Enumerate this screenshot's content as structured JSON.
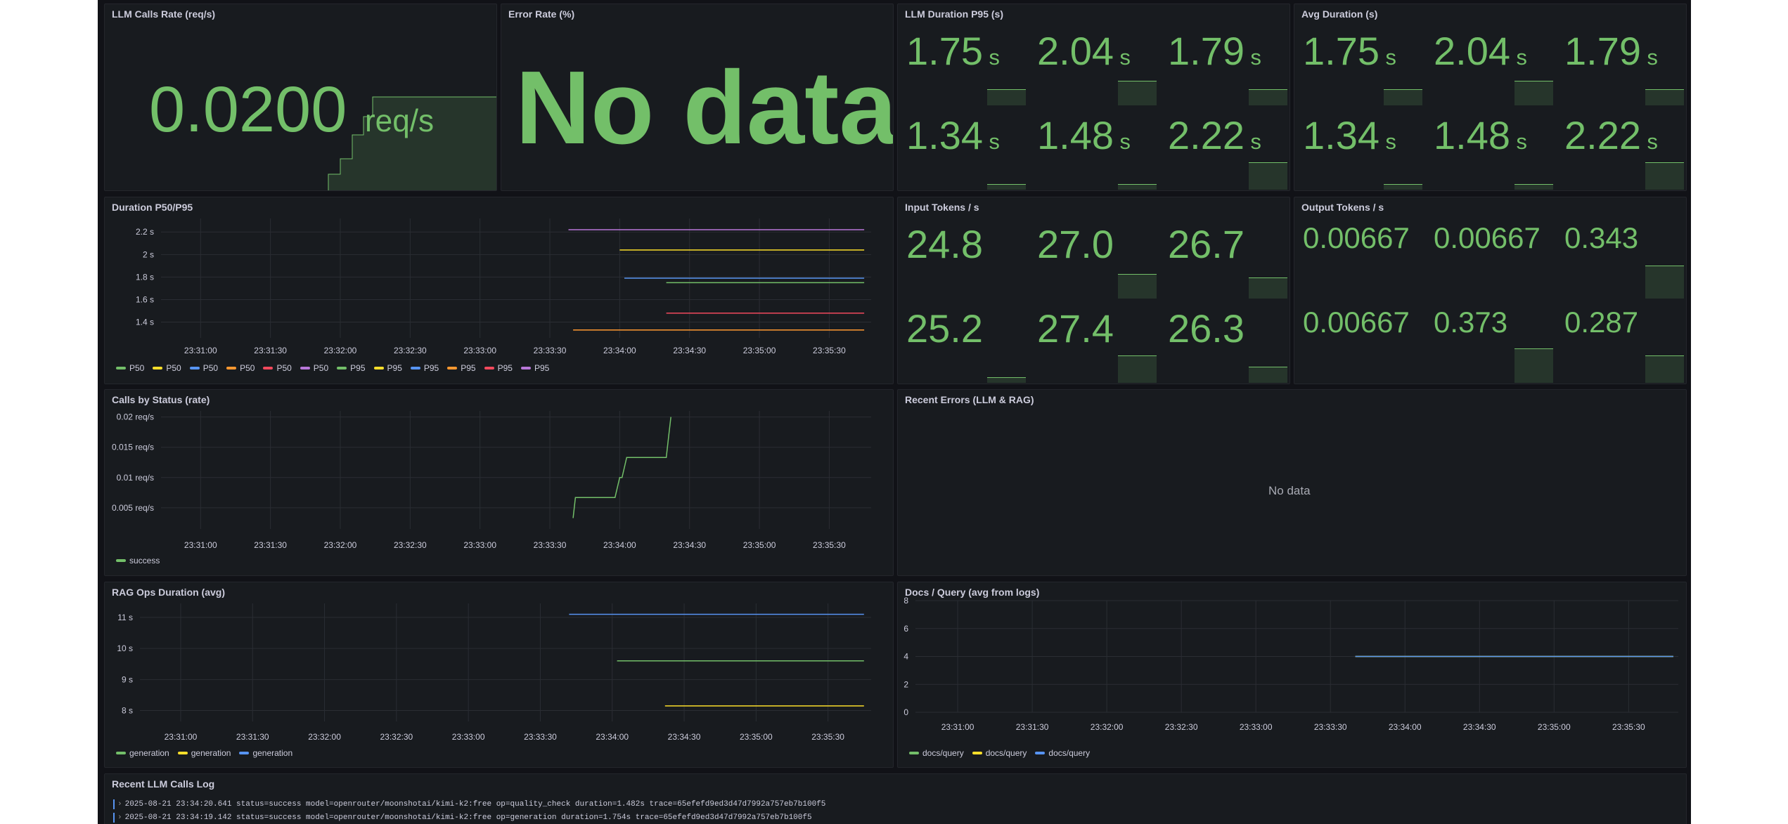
{
  "colors": {
    "green": "#73bf69",
    "yellow": "#fade2a",
    "blue": "#5794f2",
    "orange": "#ff9830",
    "red": "#f2495c",
    "purple": "#b877d9"
  },
  "panels": {
    "llm_calls_rate": {
      "title": "LLM Calls Rate (req/s)",
      "value": "0.0200",
      "unit": "req/s"
    },
    "error_rate": {
      "title": "Error Rate (%)",
      "value": "No data"
    },
    "llm_duration_p95": {
      "title": "LLM Duration P95 (s)",
      "cells": [
        {
          "value": "1.75",
          "unit": "s",
          "level": 0.45
        },
        {
          "value": "2.04",
          "unit": "s",
          "level": 0.7
        },
        {
          "value": "1.79",
          "unit": "s",
          "level": 0.45
        },
        {
          "value": "1.34",
          "unit": "s",
          "level": 0.15
        },
        {
          "value": "1.48",
          "unit": "s",
          "level": 0.15
        },
        {
          "value": "2.22",
          "unit": "s",
          "level": 0.8
        }
      ]
    },
    "avg_duration": {
      "title": "Avg Duration (s)",
      "cells": [
        {
          "value": "1.75",
          "unit": "s",
          "level": 0.45
        },
        {
          "value": "2.04",
          "unit": "s",
          "level": 0.7
        },
        {
          "value": "1.79",
          "unit": "s",
          "level": 0.45
        },
        {
          "value": "1.34",
          "unit": "s",
          "level": 0.15
        },
        {
          "value": "1.48",
          "unit": "s",
          "level": 0.15
        },
        {
          "value": "2.22",
          "unit": "s",
          "level": 0.8
        }
      ]
    },
    "duration_p50_p95": {
      "title": "Duration P50/P95"
    },
    "input_tokens": {
      "title": "Input Tokens / s",
      "cells": [
        {
          "value": "24.8",
          "level": 0
        },
        {
          "value": "27.0",
          "level": 0.7
        },
        {
          "value": "26.7",
          "level": 0.6
        },
        {
          "value": "25.2",
          "level": 0.15
        },
        {
          "value": "27.4",
          "level": 0.8
        },
        {
          "value": "26.3",
          "level": 0.45
        }
      ]
    },
    "output_tokens": {
      "title": "Output Tokens / s",
      "cells": [
        {
          "value": "0.00667",
          "level": 0
        },
        {
          "value": "0.00667",
          "level": 0
        },
        {
          "value": "0.343",
          "level": 0.95
        },
        {
          "value": "0.00667",
          "level": 0
        },
        {
          "value": "0.373",
          "level": 1
        },
        {
          "value": "0.287",
          "level": 0.8
        }
      ]
    },
    "calls_by_status": {
      "title": "Calls by Status (rate)"
    },
    "recent_errors": {
      "title": "Recent Errors (LLM & RAG)",
      "empty": "No data"
    },
    "rag_ops_duration": {
      "title": "RAG Ops Duration (avg)"
    },
    "docs_per_query": {
      "title": "Docs / Query (avg from logs)"
    },
    "recent_llm_log": {
      "title": "Recent LLM Calls Log",
      "lines": [
        "2025-08-21 23:34:20.641 status=success model=openrouter/moonshotai/kimi-k2:free op=quality_check duration=1.482s trace=65efefd9ed3d47d7992a757eb7b100f5",
        "2025-08-21 23:34:19.142 status=success model=openrouter/moonshotai/kimi-k2:free op=generation duration=1.754s trace=65efefd9ed3d47d7992a757eb7b100f5"
      ]
    }
  },
  "chart_data": [
    {
      "type": "line",
      "title": "Duration P50/P95",
      "x_ticks": [
        "23:31:00",
        "23:31:30",
        "23:32:00",
        "23:32:30",
        "23:33:00",
        "23:33:30",
        "23:34:00",
        "23:34:30",
        "23:35:00",
        "23:35:30"
      ],
      "y_ticks": [
        "1.4 s",
        "1.6 s",
        "1.8 s",
        "2 s",
        "2.2 s"
      ],
      "ylim": [
        1.26,
        2.32
      ],
      "series": [
        {
          "name": "P50",
          "color": "#73bf69",
          "x": [
            "23:34:20",
            "23:35:45"
          ],
          "values": [
            1.75,
            1.75
          ]
        },
        {
          "name": "P50",
          "color": "#fade2a",
          "x": [
            "23:34:00",
            "23:35:45"
          ],
          "values": [
            2.04,
            2.04
          ]
        },
        {
          "name": "P50",
          "color": "#5794f2",
          "x": [
            "23:34:02",
            "23:35:45"
          ],
          "values": [
            1.79,
            1.79
          ]
        },
        {
          "name": "P50",
          "color": "#ff9830",
          "x": [
            "23:33:40",
            "23:35:45"
          ],
          "values": [
            1.33,
            1.33
          ]
        },
        {
          "name": "P50",
          "color": "#f2495c",
          "x": [
            "23:34:20",
            "23:35:45"
          ],
          "values": [
            1.48,
            1.48
          ]
        },
        {
          "name": "P50",
          "color": "#b877d9",
          "x": [
            "23:33:38",
            "23:35:45"
          ],
          "values": [
            2.22,
            2.22
          ]
        },
        {
          "name": "P95",
          "color": "#73bf69",
          "x": [],
          "values": []
        },
        {
          "name": "P95",
          "color": "#fade2a",
          "x": [],
          "values": []
        },
        {
          "name": "P95",
          "color": "#5794f2",
          "x": [],
          "values": []
        },
        {
          "name": "P95",
          "color": "#ff9830",
          "x": [],
          "values": []
        },
        {
          "name": "P95",
          "color": "#f2495c",
          "x": [],
          "values": []
        },
        {
          "name": "P95",
          "color": "#b877d9",
          "x": [],
          "values": []
        }
      ]
    },
    {
      "type": "line",
      "title": "Calls by Status (rate)",
      "x_ticks": [
        "23:31:00",
        "23:31:30",
        "23:32:00",
        "23:32:30",
        "23:33:00",
        "23:33:30",
        "23:34:00",
        "23:34:30",
        "23:35:00",
        "23:35:30"
      ],
      "y_ticks": [
        "0.005 req/s",
        "0.01 req/s",
        "0.015 req/s",
        "0.02 req/s"
      ],
      "ylim": [
        0.0015,
        0.021
      ],
      "series": [
        {
          "name": "success",
          "color": "#73bf69",
          "x": [
            "23:33:40",
            "23:33:41",
            "23:33:58",
            "23:34:00",
            "23:34:01",
            "23:34:03",
            "23:34:20",
            "23:34:21",
            "23:34:22"
          ],
          "values": [
            0.0033,
            0.0067,
            0.0067,
            0.01,
            0.01,
            0.0133,
            0.0133,
            0.0167,
            0.02
          ]
        }
      ]
    },
    {
      "type": "line",
      "title": "RAG Ops Duration (avg)",
      "x_ticks": [
        "23:31:00",
        "23:31:30",
        "23:32:00",
        "23:32:30",
        "23:33:00",
        "23:33:30",
        "23:34:00",
        "23:34:30",
        "23:35:00",
        "23:35:30"
      ],
      "y_ticks": [
        "8 s",
        "9 s",
        "10 s",
        "11 s"
      ],
      "ylim": [
        7.65,
        11.45
      ],
      "series": [
        {
          "name": "generation",
          "color": "#73bf69",
          "x": [
            "23:34:02",
            "23:35:45"
          ],
          "values": [
            9.6,
            9.6
          ]
        },
        {
          "name": "generation",
          "color": "#fade2a",
          "x": [
            "23:34:22",
            "23:35:45"
          ],
          "values": [
            8.15,
            8.15
          ]
        },
        {
          "name": "generation",
          "color": "#5794f2",
          "x": [
            "23:33:42",
            "23:35:45"
          ],
          "values": [
            11.1,
            11.1
          ]
        }
      ]
    },
    {
      "type": "line",
      "title": "Docs / Query (avg from logs)",
      "x_ticks": [
        "23:31:00",
        "23:31:30",
        "23:32:00",
        "23:32:30",
        "23:33:00",
        "23:33:30",
        "23:34:00",
        "23:34:30",
        "23:35:00",
        "23:35:30"
      ],
      "y_ticks": [
        "0",
        "2",
        "4",
        "6",
        "8"
      ],
      "ylim": [
        0,
        8
      ],
      "series": [
        {
          "name": "docs/query",
          "color": "#73bf69",
          "x": [
            "23:33:40",
            "23:35:48"
          ],
          "values": [
            4,
            4
          ]
        },
        {
          "name": "docs/query",
          "color": "#fade2a",
          "x": [
            "23:33:40",
            "23:35:48"
          ],
          "values": [
            4,
            4
          ]
        },
        {
          "name": "docs/query",
          "color": "#5794f2",
          "x": [
            "23:33:40",
            "23:35:48"
          ],
          "values": [
            4,
            4
          ]
        }
      ]
    }
  ]
}
